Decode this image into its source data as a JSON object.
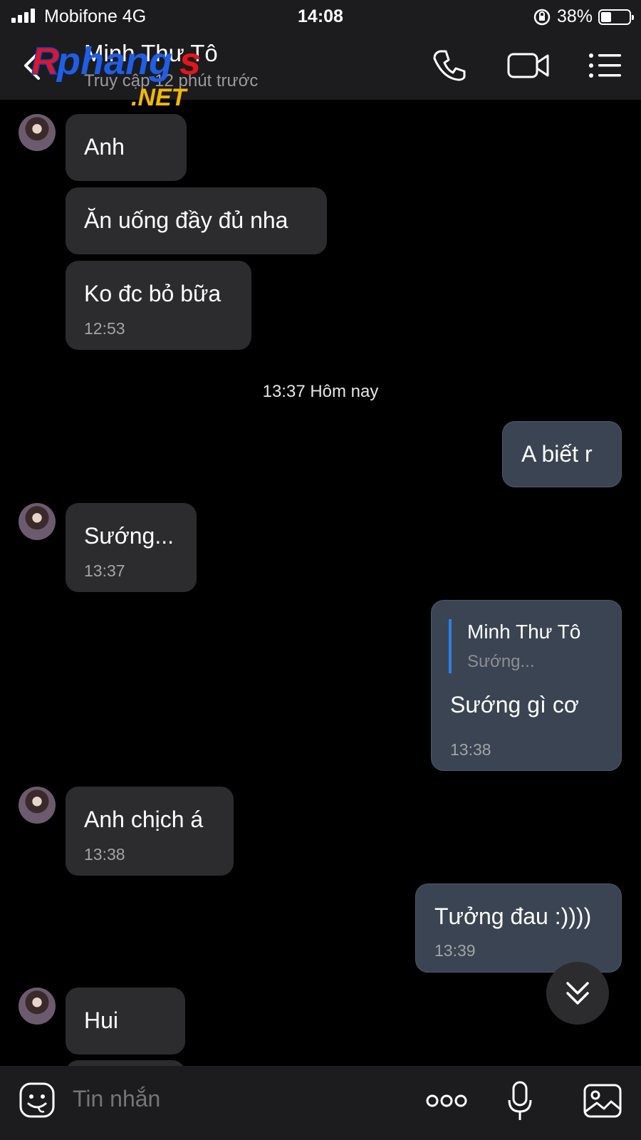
{
  "status_bar": {
    "carrier": "Mobifone  4G",
    "time": "14:08",
    "battery": "38%",
    "battery_level": 0.38
  },
  "header": {
    "contact_name": "Minh Thư Tô",
    "contact_status": "Truy cập 12 phút trước",
    "watermark": "Rphangs .NET"
  },
  "messages": [
    {
      "text": "Anh"
    },
    {
      "text": "Ăn uống đầy đủ nha"
    },
    {
      "text": "Ko đc bỏ bữa",
      "time": "12:53"
    },
    {
      "text": "A biết r"
    },
    {
      "text": "Sướng...",
      "time": "13:37"
    },
    {
      "text": "Sướng gì cơ",
      "time": "13:38",
      "quote_name": "Minh Thư Tô",
      "quote_text": "Sướng..."
    },
    {
      "text": "Anh chịch á",
      "time": "13:38"
    },
    {
      "text": "Tưởng đau :))))",
      "time": "13:39"
    },
    {
      "text": "Hui"
    }
  ],
  "date_separator": "13:37 Hôm nay",
  "input": {
    "placeholder": "Tin nhắn"
  }
}
